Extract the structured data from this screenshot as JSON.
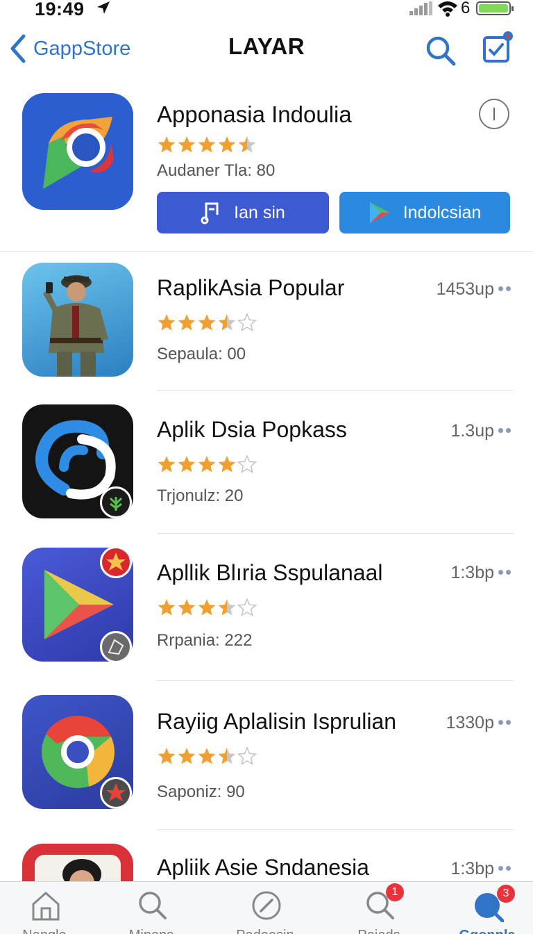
{
  "status_bar": {
    "time": "19:49",
    "battery": "6"
  },
  "nav": {
    "back_label": "GappStore",
    "title": "LAYAR"
  },
  "featured": {
    "name": "Apponasia Indoulia",
    "rating": 4.5,
    "subtitle": "Audaner Tla: 80",
    "button1_label": "Ian sin",
    "button2_label": "Indolcsian"
  },
  "apps": [
    {
      "name": "RaplikAsia Popular",
      "size": "1453up",
      "rating": 3.5,
      "meta": "Sepaula: 00"
    },
    {
      "name": "Aplik Dsia Popkass",
      "size": "1.3up",
      "rating": 4,
      "meta": "Trjonulz: 20"
    },
    {
      "name": "Apllik Blıria Sspulanaal",
      "size": "1:3bp",
      "rating": 3.5,
      "meta": "Rrpania: 222"
    },
    {
      "name": "Rayiig Aplalisin Isprulian",
      "size": "1330p",
      "rating": 3.5,
      "meta": "Saponiz: 90"
    },
    {
      "name": "Apliik Asie Sndanesia",
      "size": "1:3bp",
      "rating": 0,
      "meta": ""
    }
  ],
  "tabs": [
    {
      "label": "Nangle",
      "badge": ""
    },
    {
      "label": "Minens",
      "badge": ""
    },
    {
      "label": "Padeesin",
      "badge": ""
    },
    {
      "label": "Peiads",
      "badge": "1"
    },
    {
      "label": "Ggonnla",
      "badge": "3"
    }
  ],
  "colors": {
    "accent": "#2f74c7",
    "star": "#f0a030",
    "button_primary": "#3d5bd0",
    "button_secondary": "#2b8ae0",
    "badge": "#e8323c"
  }
}
